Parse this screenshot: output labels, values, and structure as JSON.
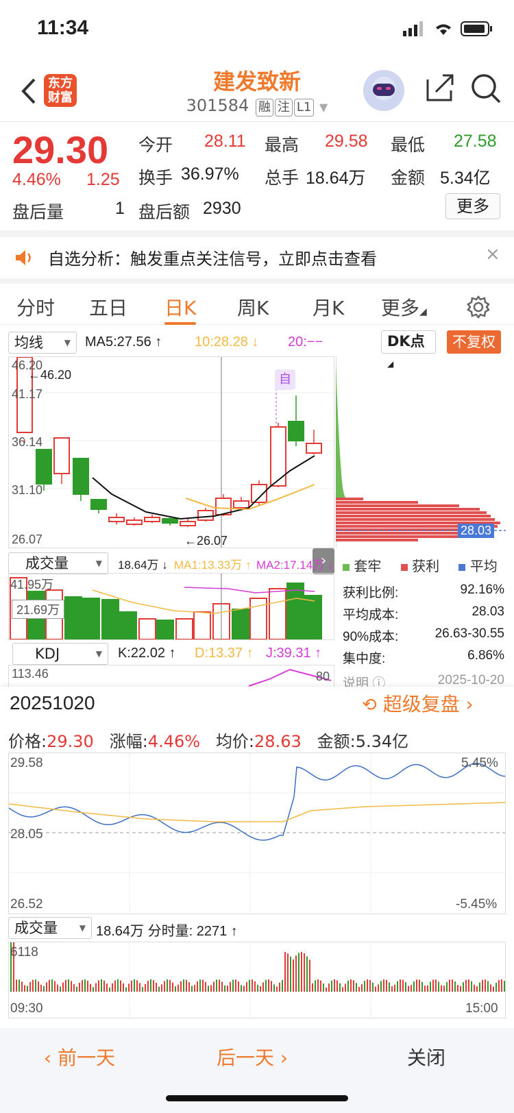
{
  "status": {
    "time": "11:34"
  },
  "header": {
    "logo_text_1": "东方",
    "logo_text_2": "财富",
    "stock_name": "建发致新",
    "stock_code": "301584",
    "tags": [
      "融",
      "注",
      "L1"
    ]
  },
  "quote": {
    "price": "29.30",
    "change_pct": "4.46%",
    "change": "1.25",
    "after_hours_vol_label": "盘后量",
    "after_hours_vol": "1",
    "after_hours_amt_label": "盘后额",
    "after_hours_amt": "2930",
    "open_label": "今开",
    "open": "28.11",
    "high_label": "最高",
    "high": "29.58",
    "low_label": "最低",
    "low": "27.58",
    "turnover_label": "换手",
    "turnover": "36.97%",
    "volume_label": "总手",
    "volume": "18.64万",
    "amount_label": "金额",
    "amount": "5.34亿",
    "more_label": "更多"
  },
  "notice": {
    "text": "自选分析：触发重点关注信号，立即点击查看",
    "close": "×"
  },
  "tabs": [
    "分时",
    "五日",
    "日K",
    "周K",
    "月K",
    "更多"
  ],
  "kline": {
    "selector": "均线",
    "ma5": "MA5:27.56 ↑",
    "ma10": "10:28.28 ↓",
    "ma20": "20:−−",
    "dk_label": "DK点",
    "fuquan_label": "不复权",
    "axis": [
      "46.20",
      "41.17",
      "36.14",
      "31.10",
      "26.07"
    ],
    "max_marker": "←46.20",
    "min_marker": "←26.07",
    "auto_badge": "自",
    "chip_price": "28.03",
    "vol_selector": "成交量",
    "vol_value": "18.64万 ↓",
    "vol_ma1": "MA1:13.33万 ↑",
    "vol_ma2": "MA2:17.14万 ↓",
    "vol_axis_top": "41.95万",
    "vol_cursor": "21.69万",
    "kdj_selector": "KDJ",
    "kdj_k": "K:22.02 ↑",
    "kdj_d": "D:13.37 ↑",
    "kdj_j": "J:39.31 ↑",
    "kdj_axis": "113.46",
    "kdj_80": "80"
  },
  "chips": {
    "legend": [
      "套牢",
      "获利",
      "平均"
    ],
    "rows": [
      {
        "label": "获利比例:",
        "value": "92.16%"
      },
      {
        "label": "平均成本:",
        "value": "28.03"
      },
      {
        "label": "90%成本:",
        "value": "26.63-30.55"
      },
      {
        "label": "集中度:",
        "value": "6.86%"
      }
    ],
    "note_label": "说明",
    "note_date": "2025-10-20"
  },
  "replay": {
    "date": "20251020",
    "button": "超级复盘",
    "price_label": "价格:",
    "price": "29.30",
    "chg_label": "涨幅:",
    "chg": "4.46%",
    "avg_label": "均价:",
    "avg": "28.63",
    "amt_label": "金额:",
    "amt": "5.34亿",
    "axis_top": "29.58",
    "axis_mid": "28.05",
    "axis_bottom": "26.52",
    "pct_top": "5.45%",
    "pct_bottom": "-5.45%",
    "vol_selector": "成交量",
    "vol_text": "18.64万 分时量: 2271 ↑",
    "vol_axis": "6118",
    "time_start": "09:30",
    "time_end": "15:00"
  },
  "nav": {
    "prev": "前一天",
    "next": "后一天",
    "close": "关闭"
  },
  "watermark": "东方财富",
  "colors": {
    "up": "#e53935",
    "down": "#2e9c2a",
    "accent": "#ef7a2c",
    "ma10": "#f4b942",
    "ma20": "#d63bd6"
  }
}
